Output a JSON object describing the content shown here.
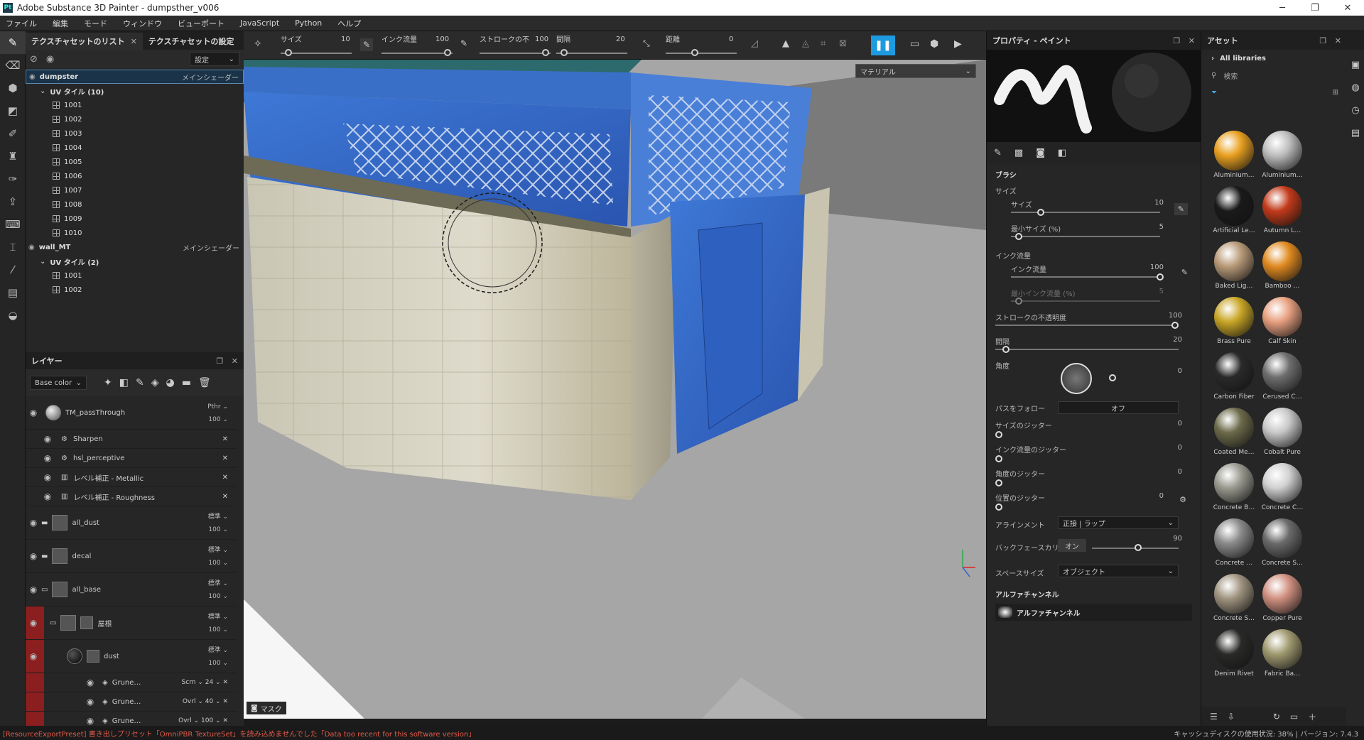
{
  "window": {
    "title": "Adobe Substance 3D Painter - dumpsther_v006",
    "app_icon": "Pt"
  },
  "menu": [
    "ファイル",
    "編集",
    "モード",
    "ウィンドウ",
    "ビューポート",
    "JavaScript",
    "Python",
    "ヘルプ"
  ],
  "texture_panel": {
    "tabs": [
      "テクスチャセットのリスト",
      "テクスチャセットの設定"
    ],
    "settings_label": "設定",
    "sets": [
      {
        "name": "dumpster",
        "shader": "メインシェーダー",
        "uv_label": "UV タイル (10)",
        "tiles": [
          "1001",
          "1002",
          "1003",
          "1004",
          "1005",
          "1006",
          "1007",
          "1008",
          "1009",
          "1010"
        ]
      },
      {
        "name": "wall_MT",
        "shader": "メインシェーダー",
        "uv_label": "UV タイル (2)",
        "tiles": [
          "1001",
          "1002"
        ]
      }
    ]
  },
  "layers_panel": {
    "title": "レイヤー",
    "channel": "Base color",
    "layers": [
      {
        "name": "TM_passThrough",
        "blend": "Pthr",
        "opacity": "100"
      },
      {
        "name": "Sharpen"
      },
      {
        "name": "hsl_perceptive"
      },
      {
        "name": "レベル補正 - Metallic"
      },
      {
        "name": "レベル補正 - Roughness"
      },
      {
        "name": "all_dust",
        "blend": "標準",
        "opacity": "100"
      },
      {
        "name": "decal",
        "blend": "標準",
        "opacity": "100"
      },
      {
        "name": "all_base",
        "blend": "標準",
        "opacity": "100"
      },
      {
        "name": "屋根",
        "blend": "標準",
        "opacity": "100"
      },
      {
        "name": "dust",
        "blend": "標準",
        "opacity": "100"
      },
      {
        "name": "Grune…",
        "blend": "Scrn",
        "opacity": "24"
      },
      {
        "name": "Grune…",
        "blend": "Ovrl",
        "opacity": "40"
      },
      {
        "name": "Grune…",
        "blend": "Ovrl",
        "opacity": "100"
      }
    ]
  },
  "viewport_toolbar": {
    "size_label": "サイズ",
    "size_value": "10",
    "flow_label": "インク流量",
    "flow_value": "100",
    "stroke_label": "ストロークの不",
    "stroke_value": "100",
    "spacing_label": "間隔",
    "spacing_value": "20",
    "distance_label": "距離",
    "distance_value": "0"
  },
  "viewport": {
    "material_dropdown": "マテリアル",
    "mask_label": "マスク"
  },
  "properties": {
    "title": "プロパティ - ペイント",
    "brush_section": "ブラシ",
    "size_section": "サイズ",
    "size_label": "サイズ",
    "size_value": "10",
    "size_frac": 0.2,
    "min_size_label": "最小サイズ (%)",
    "min_size_value": "5",
    "min_size_frac": 0.05,
    "flow_section": "インク流量",
    "flow_label": "インク流量",
    "flow_value": "100",
    "flow_frac": 1.0,
    "min_flow_label": "最小インク流量 (%)",
    "min_flow_value": "5",
    "stroke_opacity_label": "ストロークの不透明度",
    "stroke_opacity_value": "100",
    "spacing_label": "間隔",
    "spacing_value": "20",
    "angle_label": "角度",
    "angle_value": "0",
    "follow_path_label": "パスをフォロー",
    "follow_path_value": "オフ",
    "size_jitter_label": "サイズのジッター",
    "size_jitter_value": "0",
    "flow_jitter_label": "インク流量のジッター",
    "flow_jitter_value": "0",
    "angle_jitter_label": "角度のジッター",
    "angle_jitter_value": "0",
    "position_jitter_label": "位置のジッター",
    "position_jitter_value": "0",
    "alignment_label": "アラインメント",
    "alignment_value": "正接 | ラップ",
    "backface_label": "バックフェースカリング",
    "backface_toggle": "オン",
    "backface_value": "90",
    "space_size_label": "スペースサイズ",
    "space_size_value": "オブジェクト",
    "alpha_section": "アルファチャンネル",
    "alpha_value": "アルファチャンネル"
  },
  "assets": {
    "title": "アセット",
    "library": "All libraries",
    "search_placeholder": "検索",
    "items": [
      {
        "name": "Aluminium…",
        "color": "#e8a020"
      },
      {
        "name": "Aluminium…",
        "color": "#bdbdbd"
      },
      {
        "name": "Artificial Le…",
        "color": "#1a1a1a"
      },
      {
        "name": "Autumn L…",
        "color": "#c23a1a"
      },
      {
        "name": "Baked Lig…",
        "color": "#b89a78"
      },
      {
        "name": "Bamboo …",
        "color": "#e08a20"
      },
      {
        "name": "Brass Pure",
        "color": "#c9a626"
      },
      {
        "name": "Calf Skin",
        "color": "#e8a080"
      },
      {
        "name": "Carbon Fiber",
        "color": "#2a2a2a"
      },
      {
        "name": "Cerused C…",
        "color": "#6e6e6e"
      },
      {
        "name": "Coated Me…",
        "color": "#6b6a4a"
      },
      {
        "name": "Cobalt Pure",
        "color": "#c8c8c8"
      },
      {
        "name": "Concrete B…",
        "color": "#9a9a90"
      },
      {
        "name": "Concrete C…",
        "color": "#d0d0d0"
      },
      {
        "name": "Concrete …",
        "color": "#8a8a8a"
      },
      {
        "name": "Concrete S…",
        "color": "#6a6a6a"
      },
      {
        "name": "Concrete S…",
        "color": "#a09480"
      },
      {
        "name": "Copper Pure",
        "color": "#d09080"
      },
      {
        "name": "Denim Rivet",
        "color": "#2a2a28"
      },
      {
        "name": "Fabric Ba…",
        "color": "#a09a70"
      }
    ]
  },
  "status": {
    "error": "[ResourceExportPreset] 書き出しプリセット「OmniPBR TextureSet」を読み込めませんでした「Data too recent for this software version」",
    "info": "キャッシュディスクの使用状況: 38% | バージョン: 7.4.3"
  }
}
